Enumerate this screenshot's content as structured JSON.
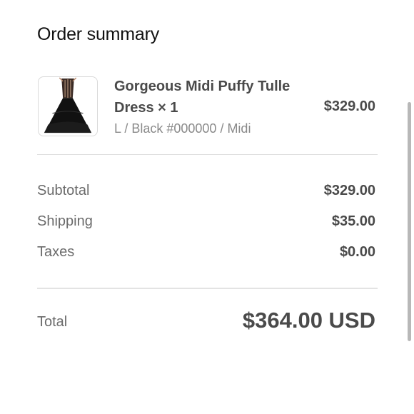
{
  "summary": {
    "title": "Order summary"
  },
  "product": {
    "name": "Gorgeous Midi Puffy Tulle Dress × 1",
    "variant": "L / Black #000000 / Midi",
    "price": "$329.00",
    "image_icon": "dress-product-image"
  },
  "totals": {
    "subtotal_label": "Subtotal",
    "subtotal_value": "$329.00",
    "shipping_label": "Shipping",
    "shipping_value": "$35.00",
    "taxes_label": "Taxes",
    "taxes_value": "$0.00",
    "total_label": "Total",
    "total_value": "$364.00 USD"
  },
  "colors": {
    "background": "#ffffff",
    "text_primary": "#111111",
    "text_strong": "#4a4a4a",
    "text_muted": "#6b6b6b",
    "divider": "#dedede"
  }
}
